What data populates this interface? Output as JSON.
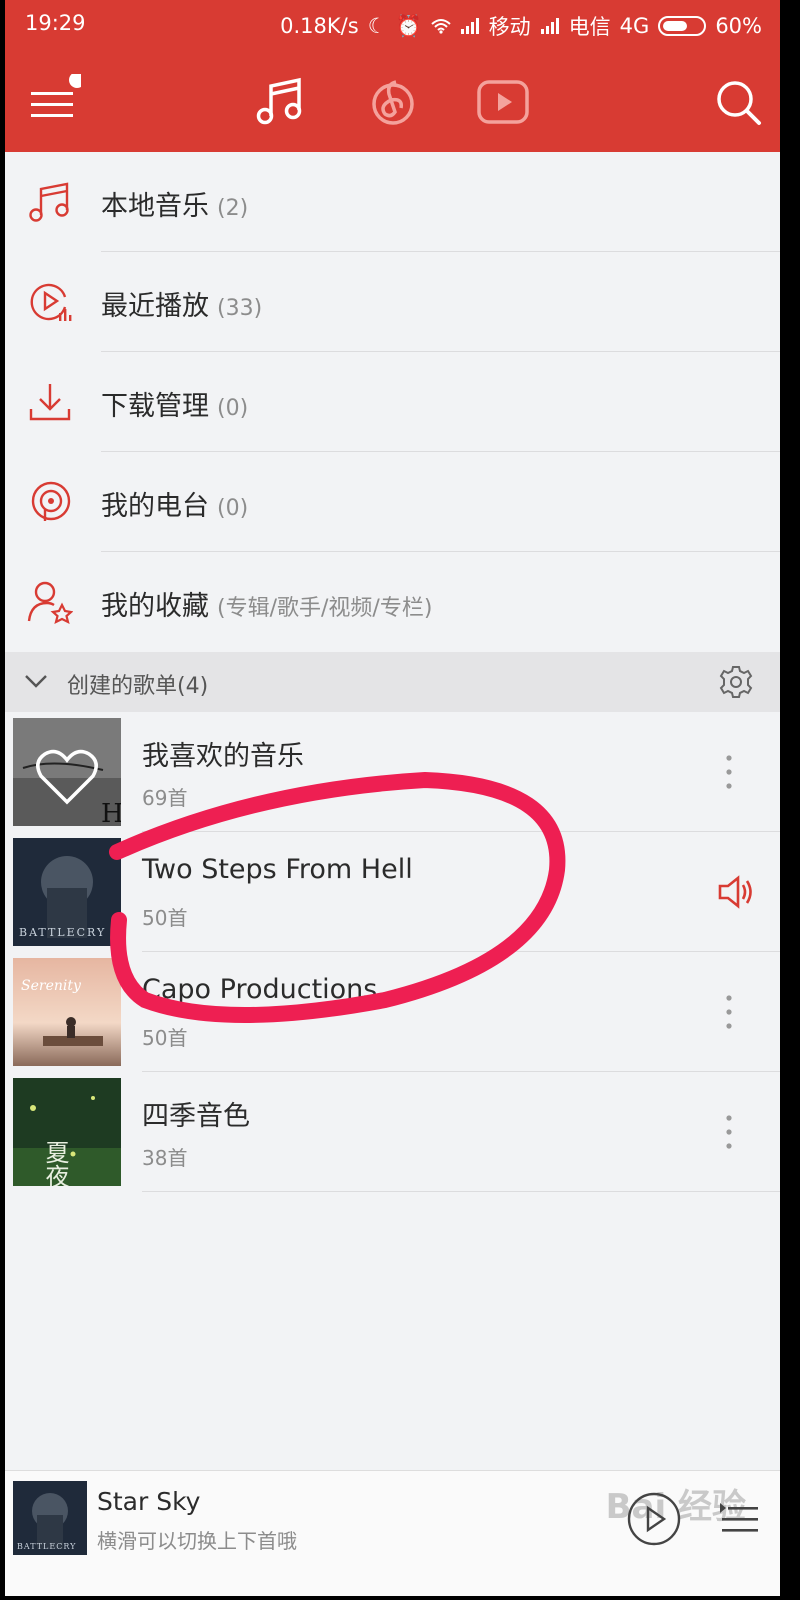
{
  "status_bar": {
    "time": "19:29",
    "speed": "0.18K/s",
    "carrier1": "移动",
    "carrier2": "电信",
    "network": "4G",
    "battery": "60%",
    "icons": [
      "moon-icon",
      "alarm-icon",
      "wifi-icon",
      "signal-icon",
      "battery-icon"
    ]
  },
  "header": {
    "icons": [
      "menu-icon",
      "music-note-icon",
      "netease-logo-icon",
      "video-play-icon",
      "search-icon"
    ],
    "accent_color": "#d83b33"
  },
  "menu": [
    {
      "label": "本地音乐",
      "count": "(2)",
      "icon": "music-note-icon"
    },
    {
      "label": "最近播放",
      "count": "(33)",
      "icon": "recent-play-icon"
    },
    {
      "label": "下载管理",
      "count": "(0)",
      "icon": "download-icon"
    },
    {
      "label": "我的电台",
      "count": "(0)",
      "icon": "radio-icon"
    },
    {
      "label": "我的收藏",
      "count": "(专辑/歌手/视频/专栏)",
      "icon": "favorite-user-icon"
    }
  ],
  "section": {
    "title": "创建的歌单(4)"
  },
  "playlists": [
    {
      "name": "我喜欢的音乐",
      "count": "69首",
      "cover_text": "H"
    },
    {
      "name": "Two Steps From Hell",
      "count": "50首",
      "playing": true,
      "cover_text": "BATTLECRY"
    },
    {
      "name": "Capo Productions",
      "count": "50首",
      "cover_text": "Serenity"
    },
    {
      "name": "四季音色",
      "count": "38首",
      "cover_text": "夏夜"
    }
  ],
  "player": {
    "title": "Star Sky",
    "subtitle": "横滑可以切换上下首哦",
    "cover_text": "BATTLECRY",
    "watermark": "Bai 经验"
  }
}
